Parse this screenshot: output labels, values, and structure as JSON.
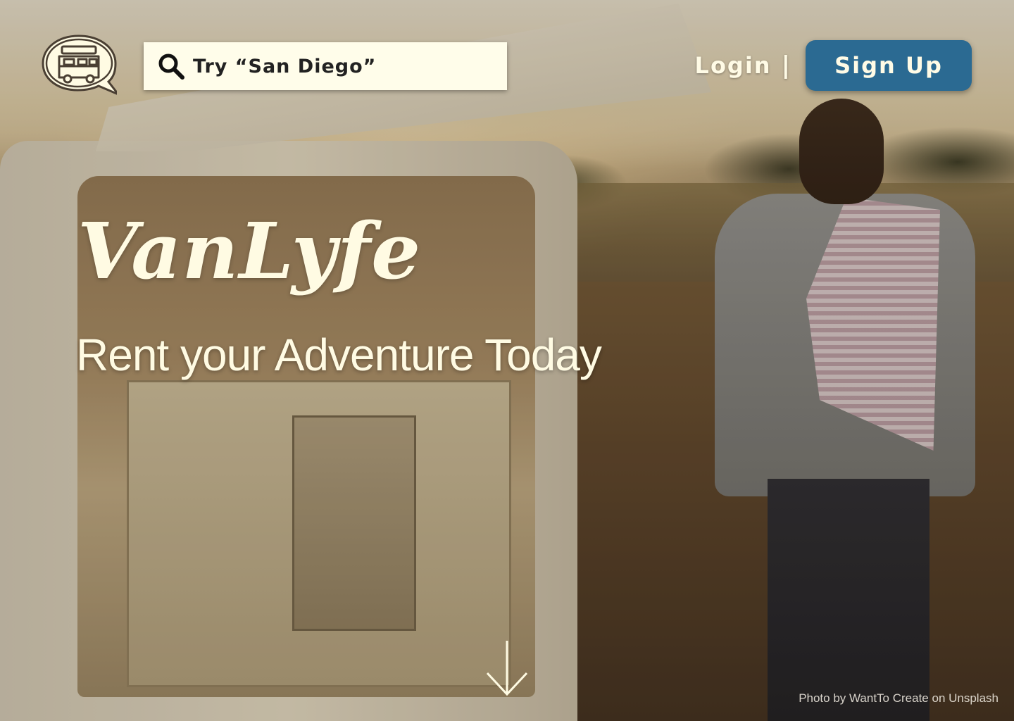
{
  "search": {
    "placeholder": "Try “San Diego”"
  },
  "nav": {
    "login_label": "Login",
    "divider": "|",
    "signup_label": "Sign Up"
  },
  "hero": {
    "title": "VanLyfe",
    "tagline": "Rent your Adventure Today"
  },
  "photo_credit": "Photo by WantTo Create on Unsplash",
  "icons": {
    "logo": "van-chat-bubble-logo",
    "search": "search-icon",
    "scroll": "arrow-down-icon"
  },
  "colors": {
    "signup_bg": "#2b6a92",
    "search_bg": "#fffdea",
    "text_light": "#fffbe3"
  }
}
